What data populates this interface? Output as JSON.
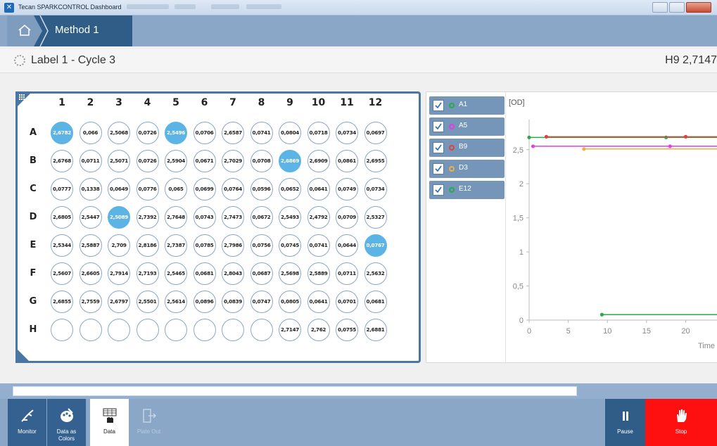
{
  "window": {
    "title": "Tecan SPARKCONTROL Dashboard"
  },
  "breadcrumb": {
    "home_icon": "home-icon",
    "method": "Method 1"
  },
  "labelbar": {
    "label": "Label 1 - Cycle 3",
    "selection": "H9 2,7147"
  },
  "plate": {
    "columns": [
      "1",
      "2",
      "3",
      "4",
      "5",
      "6",
      "7",
      "8",
      "9",
      "10",
      "11",
      "12"
    ],
    "rows": [
      {
        "label": "A",
        "wells": [
          "2,6782",
          "0,066",
          "2,5068",
          "0,0726",
          "2,5496",
          "0,0706",
          "2,6587",
          "0,0741",
          "0,0804",
          "0,0718",
          "0,0734",
          "0,0697"
        ],
        "highlight": [
          0,
          4
        ]
      },
      {
        "label": "B",
        "wells": [
          "2,6768",
          "0,0711",
          "2,5071",
          "0,0726",
          "2,5904",
          "0,0671",
          "2,7029",
          "0,0708",
          "2,6869",
          "2,6909",
          "0,0861",
          "2,6955"
        ],
        "highlight": [
          8
        ]
      },
      {
        "label": "C",
        "wells": [
          "0,0777",
          "0,1338",
          "0,0649",
          "0,0776",
          "0,065",
          "0,0699",
          "0,0764",
          "0,0596",
          "0,0652",
          "0,0641",
          "0,0749",
          "0,0734"
        ],
        "highlight": []
      },
      {
        "label": "D",
        "wells": [
          "2,6805",
          "2,5447",
          "2,5089",
          "2,7392",
          "2,7648",
          "0,0743",
          "2,7473",
          "0,0672",
          "2,5493",
          "2,4792",
          "0,0709",
          "2,5327"
        ],
        "highlight": [
          2
        ]
      },
      {
        "label": "E",
        "wells": [
          "2,5344",
          "2,5887",
          "2,709",
          "2,8186",
          "2,7387",
          "0,0785",
          "2,7986",
          "0,0756",
          "0,0745",
          "0,0741",
          "0,0644",
          "0,0767"
        ],
        "highlight": [
          11
        ]
      },
      {
        "label": "F",
        "wells": [
          "2,5607",
          "2,6605",
          "2,7914",
          "2,7193",
          "2,5465",
          "0,0681",
          "2,8043",
          "0,0687",
          "2,5698",
          "2,5889",
          "0,0711",
          "2,5632"
        ],
        "highlight": []
      },
      {
        "label": "G",
        "wells": [
          "2,6855",
          "2,7559",
          "2,6797",
          "2,5501",
          "2,5614",
          "0,0896",
          "0,0839",
          "0,0747",
          "0,0805",
          "0,0641",
          "0,0701",
          "0,0681"
        ],
        "highlight": []
      },
      {
        "label": "H",
        "wells": [
          "",
          "",
          "",
          "",
          "",
          "",
          "",
          "",
          "2,7147",
          "2,762",
          "0,0755",
          "2,6881"
        ],
        "highlight": []
      }
    ]
  },
  "legend": [
    {
      "name": "A1",
      "color": "#2aa84a"
    },
    {
      "name": "A5",
      "color": "#e040e0"
    },
    {
      "name": "B9",
      "color": "#e04040"
    },
    {
      "name": "D3",
      "color": "#f0b040"
    },
    {
      "name": "E12",
      "color": "#2aa84a"
    }
  ],
  "chart_data": {
    "type": "line",
    "ylabel": "[OD]",
    "xlabel": "Time",
    "x_ticks": [
      "0",
      "5",
      "10",
      "15",
      "20"
    ],
    "y_ticks": [
      "0",
      "0,5",
      "1",
      "1,5",
      "2",
      "2,5"
    ],
    "xlim": [
      0,
      24
    ],
    "ylim": [
      0,
      2.9
    ],
    "series": [
      {
        "name": "A1",
        "color": "#2aa84a",
        "x": [
          0,
          17.5,
          24
        ],
        "y": [
          2.68,
          2.68,
          2.68
        ]
      },
      {
        "name": "B9",
        "color": "#e04040",
        "x": [
          2.2,
          20,
          24
        ],
        "y": [
          2.69,
          2.69,
          2.69
        ]
      },
      {
        "name": "A5",
        "color": "#e040e0",
        "x": [
          0.5,
          18,
          24
        ],
        "y": [
          2.55,
          2.55,
          2.55
        ]
      },
      {
        "name": "D3",
        "color": "#f0b040",
        "x": [
          7,
          24
        ],
        "y": [
          2.51,
          2.51
        ]
      },
      {
        "name": "E12",
        "color": "#2aa84a",
        "x": [
          9.3,
          24
        ],
        "y": [
          0.08,
          0.08
        ]
      }
    ]
  },
  "progress": {
    "value": 1.0
  },
  "toolbar": {
    "monitor": "Monitor",
    "data_as_colors_1": "Data as",
    "data_as_colors_2": "Colors",
    "data": "Data",
    "plate_out": "Plate Out",
    "pause": "Pause",
    "stop": "Stop"
  }
}
